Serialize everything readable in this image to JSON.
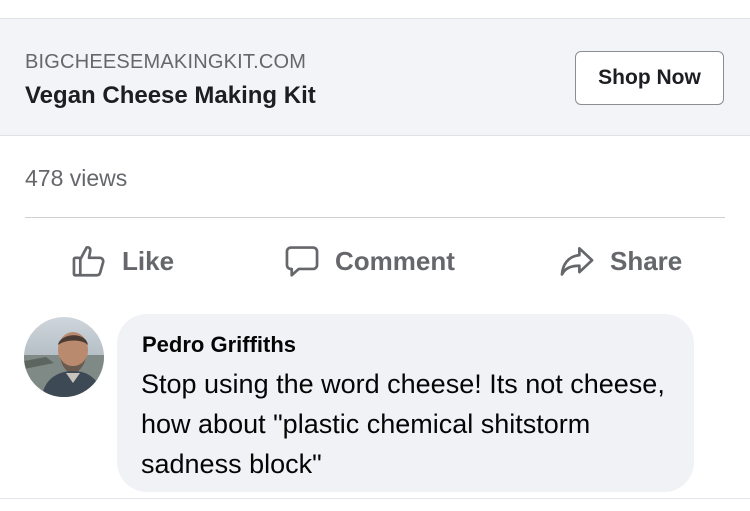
{
  "ad": {
    "domain": "BIGCHEESEMAKINGKIT.COM",
    "title": "Vegan Cheese Making Kit",
    "cta_label": "Shop Now"
  },
  "stats": {
    "views": "478 views"
  },
  "actions": {
    "like_label": "Like",
    "comment_label": "Comment",
    "share_label": "Share"
  },
  "comment": {
    "author": "Pedro Griffiths",
    "text": "Stop using the word cheese! Its not cheese, how about \"plastic chemical shitstorm sadness block\""
  },
  "colors": {
    "secondary_text": "#65676b",
    "bubble_bg": "#f0f2f5",
    "ad_bg": "#f3f4f7"
  },
  "icons": [
    "thumbs-up-icon",
    "comment-icon",
    "share-icon"
  ]
}
